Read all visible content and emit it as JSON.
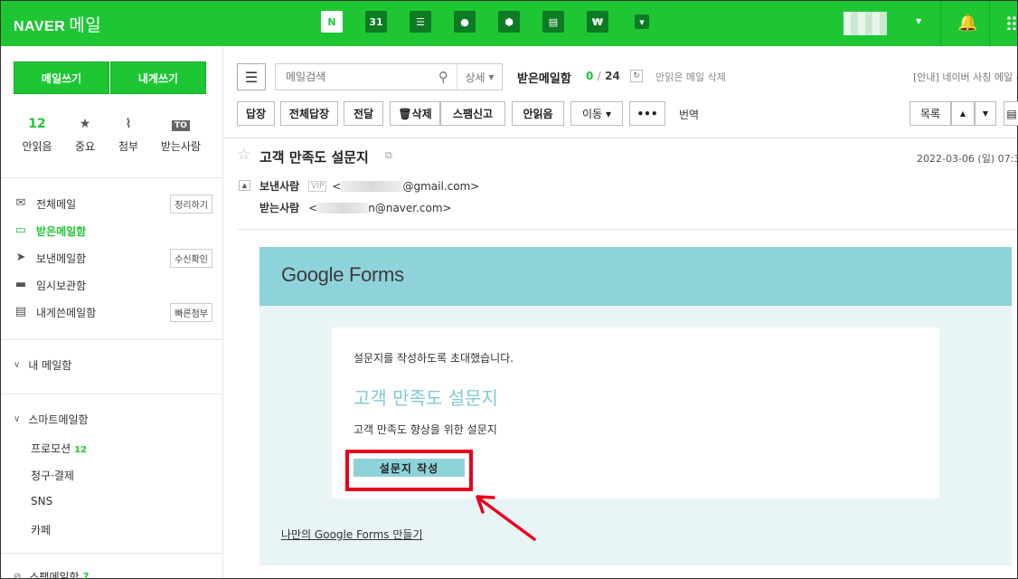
{
  "header": {
    "logo": "NAVER",
    "logo_service": "메일",
    "calendar_day": "31"
  },
  "sidebar": {
    "compose_label": "메일쓰기",
    "self_compose_label": "내게쓰기",
    "quick": [
      {
        "icon": "12",
        "label": "안읽음"
      },
      {
        "icon": "star-icon",
        "label": "중요"
      },
      {
        "icon": "clip-icon",
        "label": "첨부"
      },
      {
        "icon": "TO",
        "label": "받는사람"
      }
    ],
    "folders": [
      {
        "label": "전체메일",
        "tag": "정리하기"
      },
      {
        "label": "받은메일함",
        "tag": ""
      },
      {
        "label": "보낸메일함",
        "tag": "수신확인"
      },
      {
        "label": "임시보관함",
        "tag": ""
      },
      {
        "label": "내게쓴메일함",
        "tag": "빠른첨부"
      }
    ],
    "my_mailbox": "내 메일함",
    "smart_mailbox": "스마트메일함",
    "smart_items": [
      {
        "label": "프로모션",
        "count": "12"
      },
      {
        "label": "청구·결제",
        "count": ""
      },
      {
        "label": "SNS",
        "count": ""
      },
      {
        "label": "카페",
        "count": ""
      }
    ],
    "spam_label": "스팸메일함",
    "spam_count": "7"
  },
  "toolbar": {
    "search_placeholder": "메일검색",
    "detail_label": "상세",
    "mailbox_title": "받은메일함",
    "unread_count": "0",
    "total_count": "24",
    "delete_unread": "안읽은 메일 삭제",
    "notice": "[안내] 네이버 사칭 메일 주의",
    "reply": "답장",
    "reply_all": "전체답장",
    "forward": "전달",
    "delete": "삭제",
    "spam": "스팸신고",
    "mark_unread": "안읽음",
    "move": "이동",
    "more": "•••",
    "translate": "번역",
    "list": "목록"
  },
  "message": {
    "subject": "고객 만족도 설문지",
    "date": "2022-03-06 (일) 07:3",
    "sender_label": "보낸사람",
    "vip": "VIP",
    "sender_email": "@gmail.com>",
    "recipient_label": "받는사람",
    "recipient_email": "n@naver.com>"
  },
  "email_body": {
    "brand": "Google Forms",
    "invite_text": "설문지를 작성하도록 초대했습니다.",
    "survey_title": "고객 만족도 설문지",
    "survey_desc": "고객 만족도 향상을 위한 설문지",
    "fill_button": "설문지 작성",
    "make_link": "나만의 Google Forms 만들기"
  },
  "colors": {
    "naver_green": "#1ec634",
    "forms_teal": "#8fd3da",
    "highlight_red": "#e8001c"
  }
}
